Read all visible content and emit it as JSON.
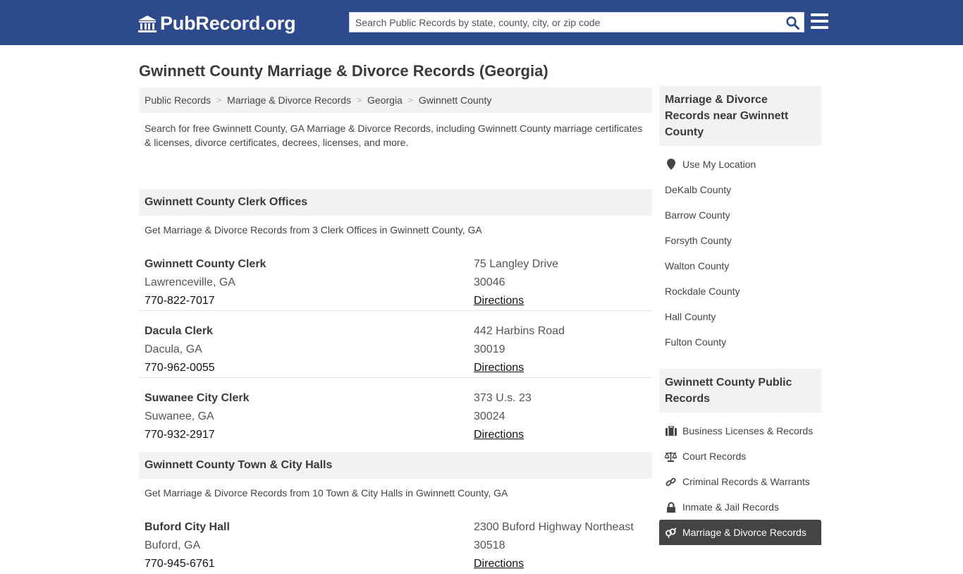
{
  "header": {
    "logo_text": "PubRecord.org",
    "search_placeholder": "Search Public Records by state, county, city, or zip code",
    "search_value": ""
  },
  "page_title": "Gwinnett County Marriage & Divorce Records (Georgia)",
  "breadcrumb": [
    "Public Records",
    "Marriage & Divorce Records",
    "Georgia",
    "Gwinnett County"
  ],
  "intro": "Search for free Gwinnett County, GA Marriage & Divorce Records, including Gwinnett County marriage certificates & licenses, divorce certificates, decrees, licenses, and more.",
  "sections": [
    {
      "title": "Gwinnett County Clerk Offices",
      "subtitle": "Get Marriage & Divorce Records from 3 Clerk Offices in Gwinnett County, GA",
      "records": [
        {
          "name": "Gwinnett County Clerk",
          "city": "Lawrenceville, GA",
          "phone": "770-822-7017",
          "address": "75 Langley Drive",
          "zip": "30046",
          "directions": "Directions"
        },
        {
          "name": "Dacula Clerk",
          "city": "Dacula, GA",
          "phone": "770-962-0055",
          "address": "442 Harbins Road",
          "zip": "30019",
          "directions": "Directions"
        },
        {
          "name": "Suwanee City Clerk",
          "city": "Suwanee, GA",
          "phone": "770-932-2917",
          "address": "373 U.s. 23",
          "zip": "30024",
          "directions": "Directions"
        }
      ]
    },
    {
      "title": "Gwinnett County Town & City Halls",
      "subtitle": "Get Marriage & Divorce Records from 10 Town & City Halls in Gwinnett County, GA",
      "records": [
        {
          "name": "Buford City Hall",
          "city": "Buford, GA",
          "phone": "770-945-6761",
          "address": "2300 Buford Highway Northeast",
          "zip": "30518",
          "directions": "Directions"
        }
      ]
    }
  ],
  "sidebar": {
    "nearby_title": "Marriage & Divorce Records near Gwinnett County",
    "nearby_items": [
      {
        "label": "Use My Location",
        "icon": "map-marker-icon"
      },
      {
        "label": "DeKalb County"
      },
      {
        "label": "Barrow County"
      },
      {
        "label": "Forsyth County"
      },
      {
        "label": "Walton County"
      },
      {
        "label": "Rockdale County"
      },
      {
        "label": "Hall County"
      },
      {
        "label": "Fulton County"
      }
    ],
    "public_title": "Gwinnett County Public Records",
    "public_items": [
      {
        "label": "Business Licenses & Records",
        "icon": "briefcase-icon"
      },
      {
        "label": "Court Records",
        "icon": "scales-icon"
      },
      {
        "label": "Criminal Records & Warrants",
        "icon": "link-icon"
      },
      {
        "label": "Inmate & Jail Records",
        "icon": "lock-icon"
      },
      {
        "label": "Marriage & Divorce Records",
        "icon": "gender-rings-icon",
        "active": true
      }
    ]
  },
  "colors": {
    "header_bg": "#2d4a8c",
    "search_icon": "#2d4a8c",
    "panel_bg": "#f2f2f2",
    "active_item_bg": "#444444"
  }
}
